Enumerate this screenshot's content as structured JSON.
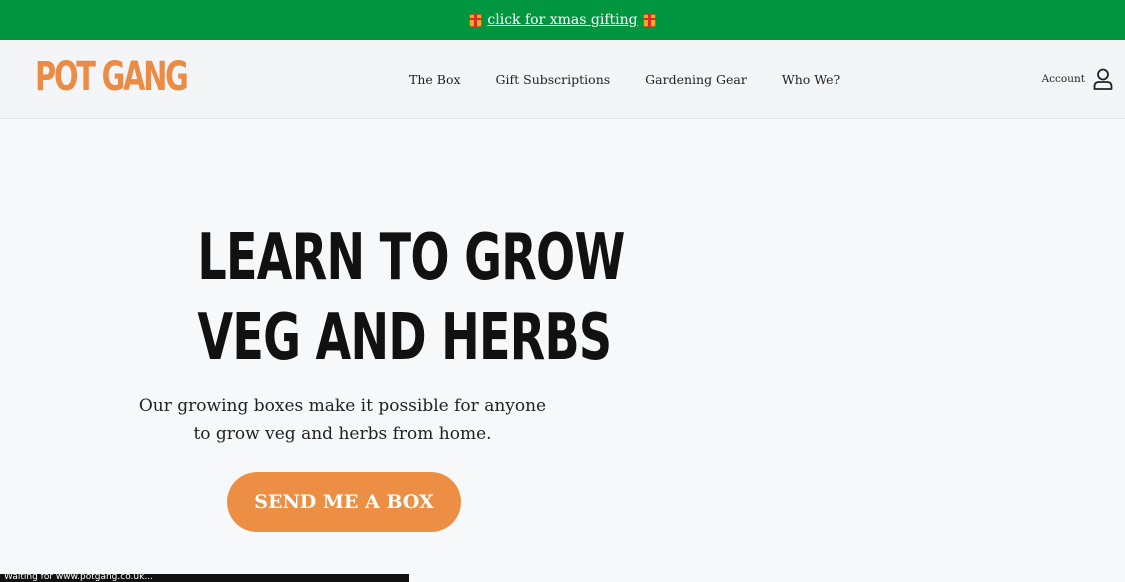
{
  "announcement": {
    "text": "click for xmas gifting",
    "icon": "gift-icon"
  },
  "header": {
    "logo": "POT GANG",
    "nav": [
      {
        "label": "The Box"
      },
      {
        "label": "Gift Subscriptions"
      },
      {
        "label": "Gardening Gear"
      },
      {
        "label": "Who We?"
      }
    ],
    "account_label": "Account",
    "account_icon": "user-icon"
  },
  "hero": {
    "title_line1": "LEARN TO GROW",
    "title_line2": "VEG AND HERBS",
    "subtitle_line1": "Our growing boxes make it possible for anyone",
    "subtitle_line2": "to grow veg and herbs from home.",
    "cta_label": "SEND ME A BOX"
  },
  "status_bar": {
    "text": "Waiting for www.potgang.co.uk..."
  },
  "colors": {
    "announcement_bg": "#00963f",
    "brand_orange": "#ec8f45",
    "page_bg": "#f7f8fa"
  }
}
